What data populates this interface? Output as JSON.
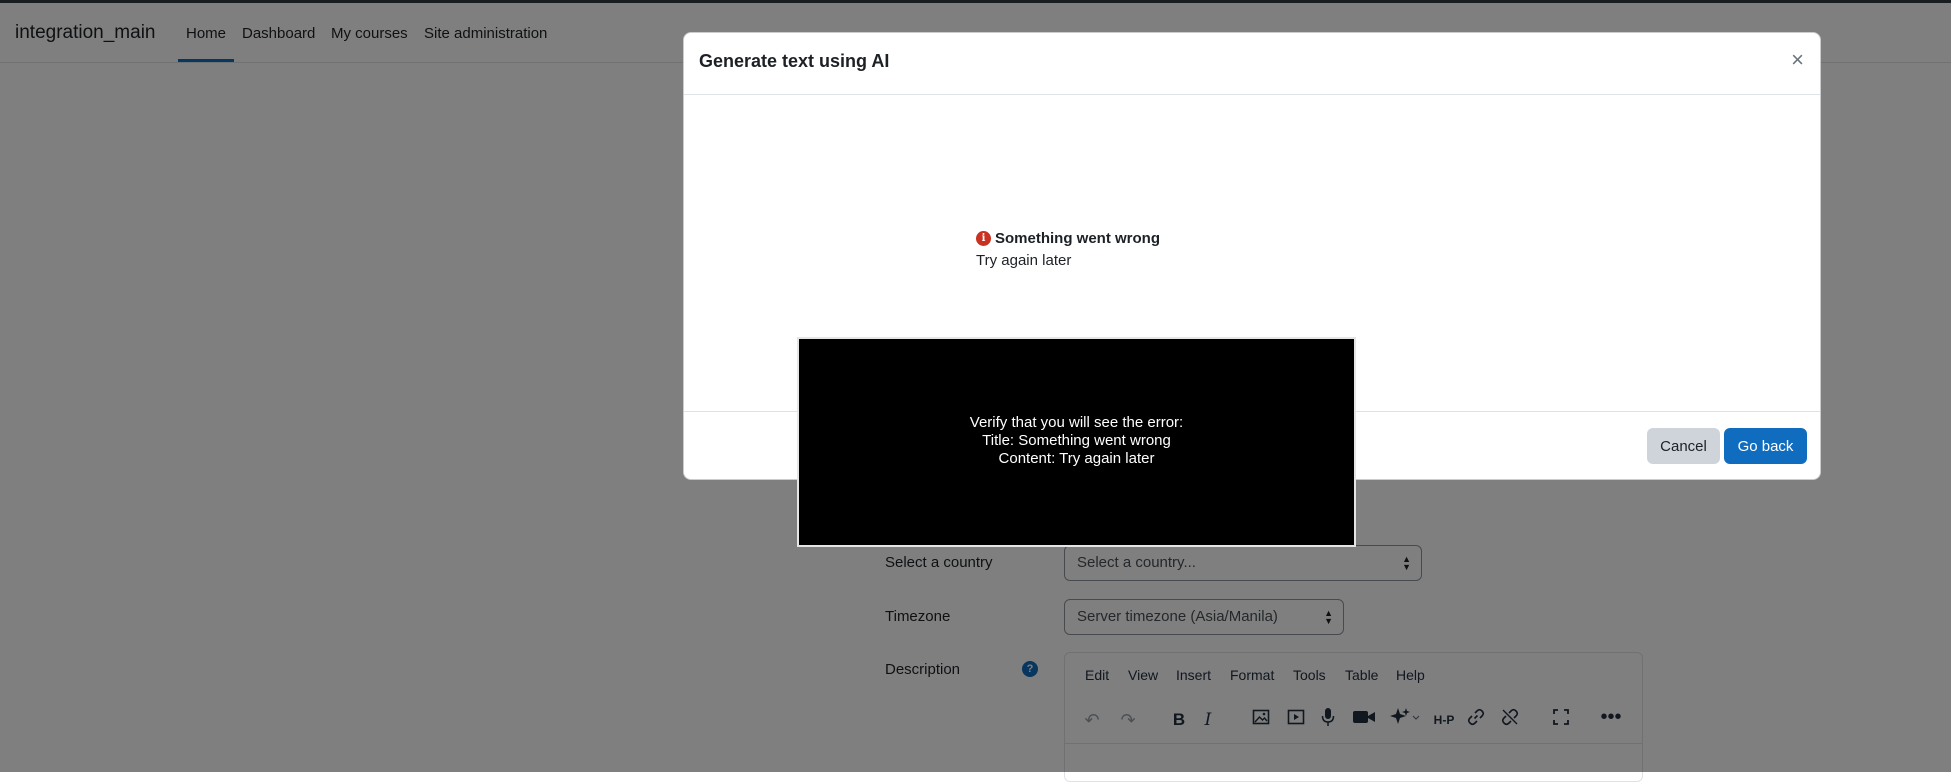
{
  "navbar": {
    "brand": "integration_main",
    "items": [
      {
        "label": "Home"
      },
      {
        "label": "Dashboard"
      },
      {
        "label": "My courses"
      },
      {
        "label": "Site administration"
      }
    ]
  },
  "form": {
    "country_label": "Select a country",
    "country_value": "Select a country...",
    "timezone_label": "Timezone",
    "timezone_value": "Server timezone (Asia/Manila)",
    "description_label": "Description",
    "help_icon": "?"
  },
  "editor": {
    "menu": [
      "Edit",
      "View",
      "Insert",
      "Format",
      "Tools",
      "Table",
      "Help"
    ],
    "toolbar_icons": [
      "undo-icon",
      "redo-icon",
      "bold-icon",
      "italic-icon",
      "image-icon",
      "media-icon",
      "microphone-icon",
      "video-icon",
      "ai-sparkle-icon",
      "h5p-icon",
      "link-icon",
      "unlink-icon",
      "fullscreen-icon",
      "more-icon"
    ],
    "bold_glyph": "B",
    "italic_glyph": "I",
    "h5p_text": "H-P"
  },
  "modal": {
    "title": "Generate text using AI",
    "close_glyph": "×",
    "error_title": "Something went wrong",
    "error_content": "Try again later",
    "cancel_label": "Cancel",
    "go_back_label": "Go back"
  },
  "overlay": {
    "line1": "Verify that you will see the error:",
    "line2": "Title: Something went wrong",
    "line3": "Content: Try again later"
  },
  "colors": {
    "primary": "#0f6cbf",
    "error": "#ca3120",
    "secondary_button": "#ced4da"
  }
}
